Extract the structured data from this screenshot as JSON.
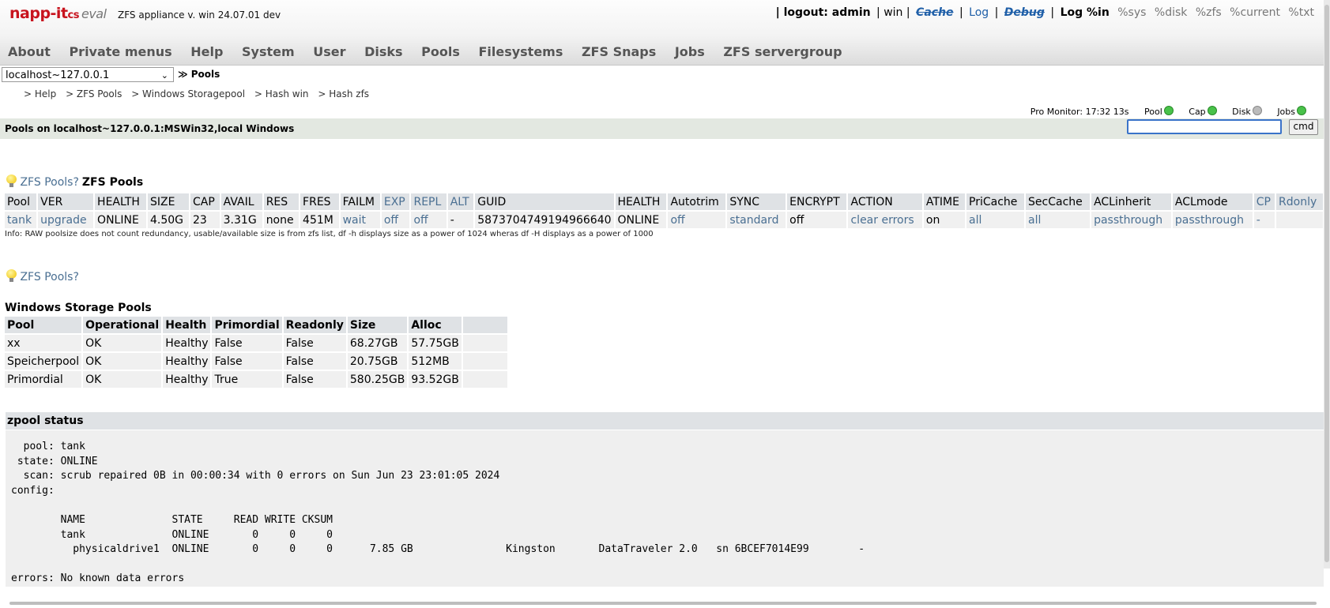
{
  "header": {
    "logo_main": "napp-it",
    "logo_suffix": "cs",
    "logo_eval": "eval",
    "app_name": "ZFS appliance v. win 24.07.01 dev",
    "top_links": {
      "logout": "| logout: admin",
      "win": "| win |",
      "cache": "Cache",
      "log": "Log",
      "debug": "Debug",
      "sep": "|",
      "logwin": "Log %in",
      "sys": "%sys",
      "disk": "%disk",
      "zfs": "%zfs",
      "current": "%current",
      "txt": "%txt"
    },
    "menu": [
      "About",
      "Private menus",
      "Help",
      "System",
      "User",
      "Disks",
      "Pools",
      "Filesystems",
      "ZFS Snaps",
      "Jobs",
      "ZFS servergroup"
    ]
  },
  "host": {
    "selected": "localhost~127.0.0.1",
    "crumb": "≫ Pools"
  },
  "breadcrumb": [
    ">  Help",
    ">  ZFS Pools",
    ">  Windows Storagepool",
    ">  Hash win",
    ">  Hash zfs"
  ],
  "pro_monitor": {
    "label": "Pro Monitor: 17:32 13s",
    "pool": "Pool",
    "cap": "Cap",
    "disk": "Disk",
    "jobs": "Jobs"
  },
  "title_bar": "Pools on localhost~127.0.0.1:MSWin32,local Windows",
  "cmd_button": "cmd",
  "zfs_section": {
    "link": "ZFS Pools?",
    "title": "ZFS Pools",
    "headers": [
      "Pool",
      "VER",
      "HEALTH",
      "SIZE",
      "CAP",
      "AVAIL",
      "RES",
      "FRES",
      "FAILM",
      "EXP",
      "REPL",
      "ALT",
      "GUID",
      "HEALTH",
      "Autotrim",
      "SYNC",
      "ENCRYPT",
      "ACTION",
      "ATIME",
      "PriCache",
      "SecCache",
      "ACLinherit",
      "ACLmode",
      "CP",
      "Rdonly"
    ],
    "row": [
      "tank",
      "upgrade",
      "ONLINE",
      "4.50G",
      "23",
      "3.31G",
      "none",
      "451M",
      "wait",
      "off",
      "off",
      "-",
      "5873704749194966640",
      "ONLINE",
      "off",
      "standard",
      "off",
      "clear errors",
      "on",
      "all",
      "all",
      "passthrough",
      "passthrough",
      "-",
      ""
    ],
    "info": "Info: RAW poolsize does not count redundancy, usable/available size is from zfs list, df -h displays size as a power of 1024 wheras df -H displays as a power of 1000"
  },
  "win_section": {
    "link": "ZFS Pools?",
    "title": "Windows Storage Pools",
    "headers": [
      "Pool",
      "Operational",
      "Health",
      "Primordial",
      "Readonly",
      "Size",
      "Alloc",
      ""
    ],
    "rows": [
      [
        "xx",
        "OK",
        "Healthy",
        "False",
        "False",
        "68.27GB",
        "57.75GB",
        ""
      ],
      [
        "Speicherpool",
        "OK",
        "Healthy",
        "False",
        "False",
        "20.75GB",
        "512MB",
        ""
      ],
      [
        "Primordial",
        "OK",
        "Healthy",
        "True",
        "False",
        "580.25GB",
        "93.52GB",
        ""
      ]
    ]
  },
  "zpool_status": {
    "title": "zpool status",
    "text": "  pool: tank\n state: ONLINE\n  scan: scrub repaired 0B in 00:00:34 with 0 errors on Sun Jun 23 23:01:05 2024\nconfig:\n\n        NAME              STATE     READ WRITE CKSUM\n        tank              ONLINE       0     0     0\n          physicaldrive1  ONLINE       0     0     0      7.85 GB               Kingston       DataTraveler 2.0   sn 6BCEF7014E99        -\n\nerrors: No known data errors"
  }
}
